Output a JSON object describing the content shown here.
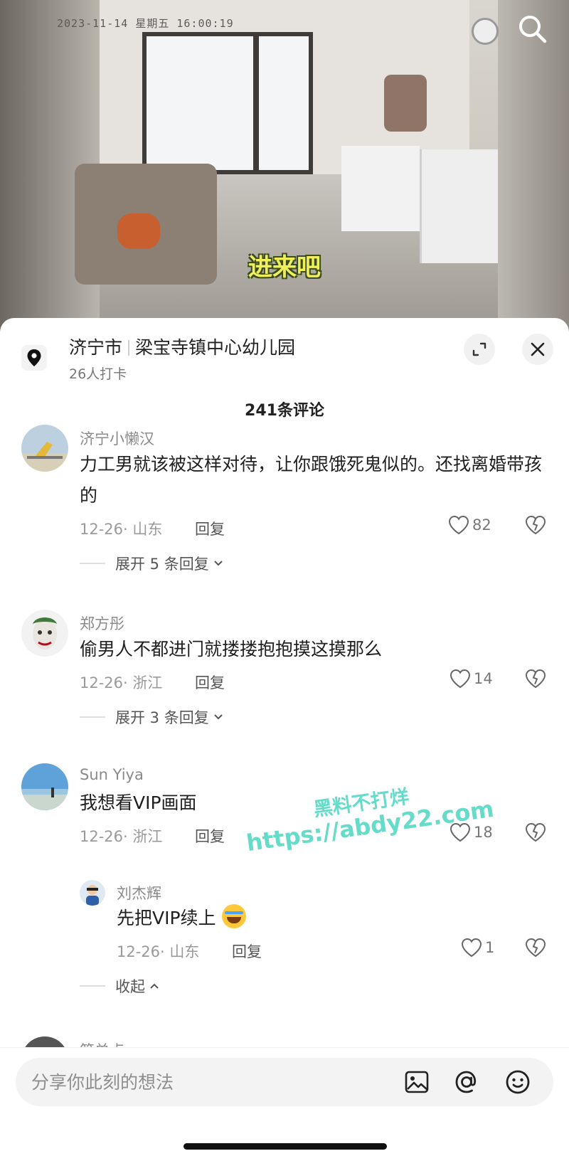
{
  "video": {
    "camera_timestamp": "2023-11-14  星期五  16:00:19",
    "subtitle": "进来吧"
  },
  "location": {
    "city": "济宁市",
    "place": "梁宝寺镇中心幼儿园",
    "checkins": "26人打卡"
  },
  "comments_header": {
    "count_label": "241条评论"
  },
  "comments": [
    {
      "name": "济宁小懒汉",
      "text": "力工男就该被这样对待，让你跟饿死鬼似的。还找离婚带孩的",
      "meta": "12-26· 山东",
      "reply": "回复",
      "likes": "82",
      "expand": "展开 5 条回复"
    },
    {
      "name": "郑方彤",
      "text": "偷男人不都进门就搂搂抱抱摸这摸那么",
      "meta": "12-26· 浙江",
      "reply": "回复",
      "likes": "14",
      "expand": "展开 3 条回复"
    },
    {
      "name": "Sun Yiya",
      "text": "我想看VIP画面",
      "meta": "12-26· 浙江",
      "reply": "回复",
      "likes": "18"
    },
    {
      "name": "刘杰辉",
      "text": "先把VIP续上",
      "meta": "12-26· 山东",
      "reply": "回复",
      "likes": "1",
      "collapse": "收起"
    },
    {
      "name": "简单点"
    }
  ],
  "watermark": {
    "line1": "黑料不打烊",
    "line2": "https://abdy22.com"
  },
  "composer": {
    "placeholder": "分享你此刻的想法"
  },
  "colors": {
    "subtitle": "#f1ef5b",
    "watermark": "#59d9c6"
  }
}
